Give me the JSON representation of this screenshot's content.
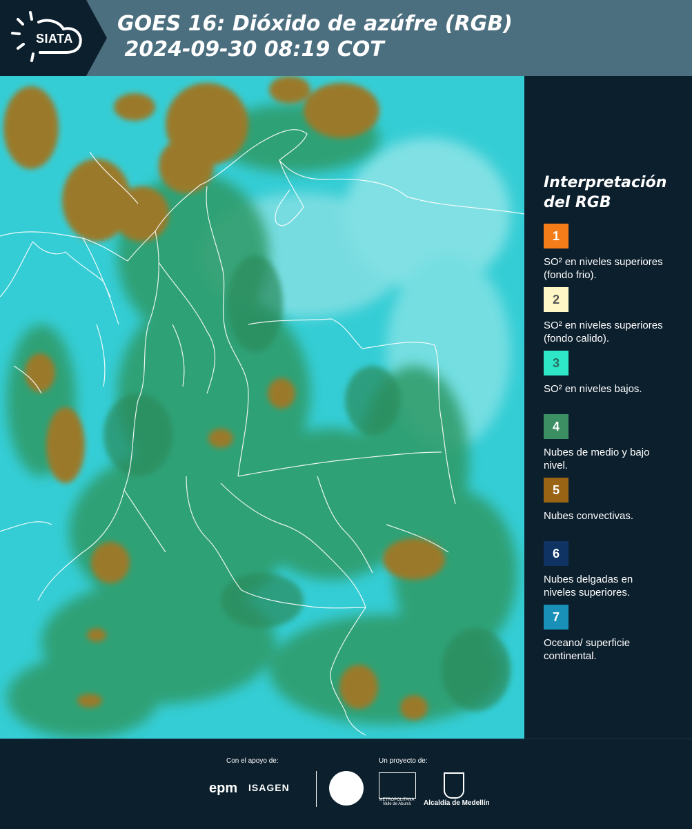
{
  "header": {
    "logo_text": "SIATA",
    "title_line1": "GOES 16: Dióxido de azúfre (RGB)",
    "title_line2": " 2024-09-30 08:19 COT"
  },
  "legend": {
    "title_line1": "Interpretación",
    "title_line2": "del RGB",
    "items": [
      {
        "num": "1",
        "color": "#f47d1a",
        "num_color": "#ffffff",
        "text": "SO² en niveles superiores (fondo frio)."
      },
      {
        "num": "2",
        "color": "#fff8c6",
        "num_color": "#555555",
        "text": "SO² en niveles superiores (fondo calido)."
      },
      {
        "num": "3",
        "color": "#2ee7c6",
        "num_color": "#2b6b64",
        "text": "SO² en niveles bajos."
      },
      {
        "num": "4",
        "color": "#3c8f63",
        "num_color": "#ffffff",
        "text": "Nubes de medio y bajo nivel."
      },
      {
        "num": "5",
        "color": "#996515",
        "num_color": "#ffffff",
        "text": "Nubes convectivas."
      },
      {
        "num": "6",
        "color": "#0f3464",
        "num_color": "#ffffff",
        "text": "Nubes delgadas en niveles superiores."
      },
      {
        "num": "7",
        "color": "#1990b8",
        "num_color": "#ffffff",
        "text": "Oceano/ superficie continental."
      }
    ]
  },
  "footer": {
    "support_label": "Con el apoyo de:",
    "project_label": "Un proyecto de:",
    "epm": "epm",
    "isagen": "ISAGEN",
    "area_sub": "METROPOLITANA Valle de Aburrá",
    "alcaldia": "Alcaldía de Medellín"
  }
}
